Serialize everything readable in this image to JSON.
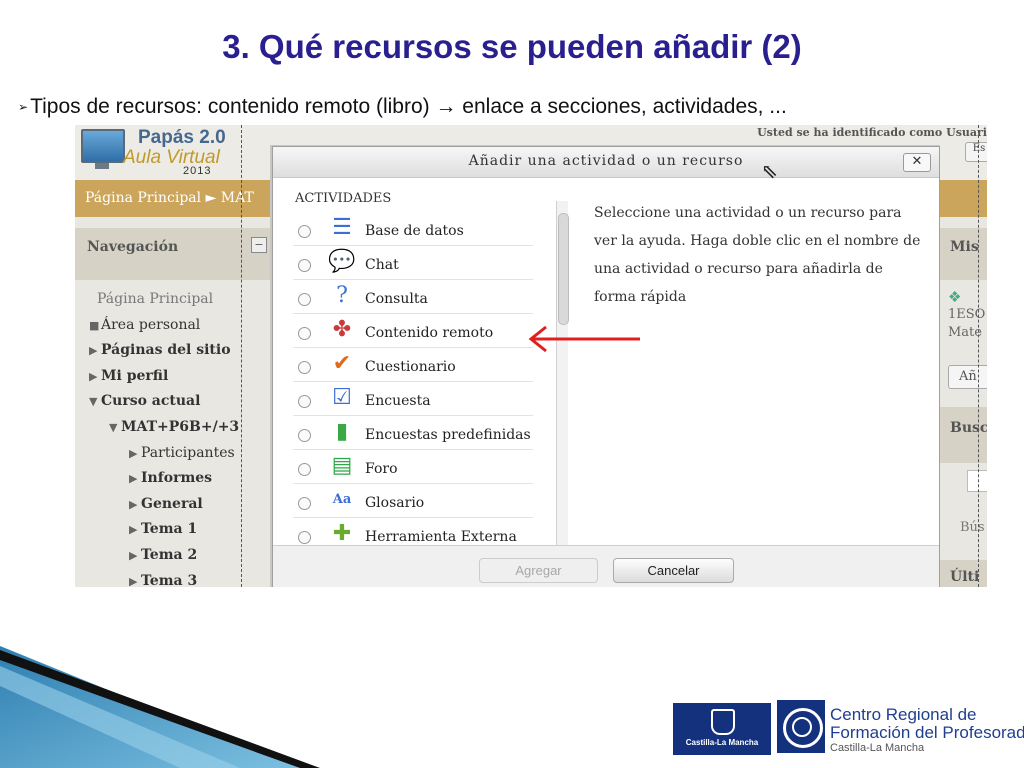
{
  "slide": {
    "title": "3. Qué recursos se pueden añadir (2)",
    "subtitle": "Tipos de recursos: contenido remoto (libro) → enlace a secciones, actividades, ..."
  },
  "moodle": {
    "logo": {
      "line1": "Papás 2.0",
      "line2": "Aula Virtual",
      "year": "2013"
    },
    "user_status": "Usted se ha identificado como Usuari",
    "login_button": "Es",
    "breadcrumb": "Página Principal ► MAT",
    "navigation": {
      "heading": "Navegación",
      "toggle": "−",
      "items": [
        {
          "label": "Página Principal",
          "marker": ""
        },
        {
          "label": "Área personal",
          "marker": "■"
        },
        {
          "label": "Páginas del sitio",
          "marker": "▶"
        },
        {
          "label": "Mi perfil",
          "marker": "▶"
        },
        {
          "label": "Curso actual",
          "marker": "▼"
        },
        {
          "label": "MAT+P6B+/+3",
          "marker": "▼"
        },
        {
          "label": "Participantes",
          "marker": "▶"
        },
        {
          "label": "Informes",
          "marker": "▶"
        },
        {
          "label": "General",
          "marker": "▶"
        },
        {
          "label": "Tema 1",
          "marker": "▶"
        },
        {
          "label": "Tema 2",
          "marker": "▶"
        },
        {
          "label": "Tema 3",
          "marker": "▶"
        }
      ]
    },
    "right_column": {
      "block1_heading": "Mis",
      "course_code": "1ESO",
      "course_name": "Mate",
      "button_partial": "Añ",
      "block2_heading": "Busc",
      "search_label": "Bús",
      "block3_heading": "Últi"
    }
  },
  "dialog": {
    "title": "Añadir una actividad o un recurso",
    "close": "✕",
    "section_heading": "ACTIVIDADES",
    "activities": [
      {
        "label": "Base de datos",
        "icon": "database-icon",
        "glyph": "☰",
        "color": "#3a6fd8"
      },
      {
        "label": "Chat",
        "icon": "chat-icon",
        "glyph": "💬",
        "color": "#e8a21a"
      },
      {
        "label": "Consulta",
        "icon": "question-icon",
        "glyph": "?",
        "color": "#3a73d6"
      },
      {
        "label": "Contenido remoto",
        "icon": "remote-content-icon",
        "glyph": "✤",
        "color": "#cc3b3b"
      },
      {
        "label": "Cuestionario",
        "icon": "quiz-icon",
        "glyph": "✔",
        "color": "#e06a1b"
      },
      {
        "label": "Encuesta",
        "icon": "survey-icon",
        "glyph": "☑",
        "color": "#3a6fd8"
      },
      {
        "label": "Encuestas predefinidas",
        "icon": "bar-chart-icon",
        "glyph": "▮",
        "color": "#3aa845"
      },
      {
        "label": "Foro",
        "icon": "forum-icon",
        "glyph": "▤",
        "color": "#2fa84a"
      },
      {
        "label": "Glosario",
        "icon": "glossary-icon",
        "glyph": "Aa",
        "color": "#3a6fd8"
      },
      {
        "label": "Herramienta Externa",
        "icon": "puzzle-icon",
        "glyph": "✚",
        "color": "#6aab2e"
      }
    ],
    "help_text": "Seleccione una actividad o un recurso para ver la ayuda. Haga doble clic en el nombre de una actividad o recurso para añadirla de forma rápida",
    "add_button": "Agregar",
    "cancel_button": "Cancelar"
  },
  "colors": {
    "title": "#2a1f8f",
    "breadcrumb": "#cba55c",
    "annotation_arrow": "#e02020"
  },
  "footer": {
    "jccm_label": "Castilla-La Mancha",
    "crfp_line1": "Centro Regional de",
    "crfp_line2": "Formación del Profesorado",
    "crfp_line3": "Castilla-La Mancha"
  }
}
